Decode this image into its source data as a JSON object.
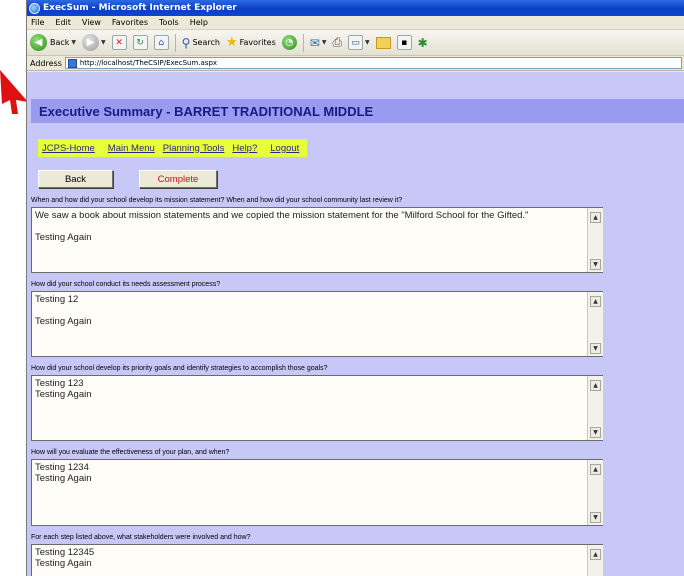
{
  "window": {
    "title": "ExecSum - Microsoft Internet Explorer"
  },
  "menu": [
    "File",
    "Edit",
    "View",
    "Favorites",
    "Tools",
    "Help"
  ],
  "toolbar": {
    "back_label": "Back",
    "search_label": "Search",
    "favorites_label": "Favorites"
  },
  "address": {
    "label": "Address",
    "url": "http://localhost/TheCSIP/ExecSum.aspx"
  },
  "page": {
    "title": "Executive Summary - BARRET TRADITIONAL MIDDLE",
    "nav": [
      "JCPS-Home",
      "Main Menu",
      "Planning Tools",
      "Help?",
      "Logout"
    ],
    "back_button": "Back",
    "complete_button": "Complete",
    "questions": [
      {
        "label": "When and how did your school develop its mission statement? When and how did your school community last review it?",
        "answer": "We saw a book about mission statements and we copied the mission statement for the \"Milford School for the Gifted.\"\n\nTesting Again"
      },
      {
        "label": "How did your school conduct its needs assessment process?",
        "answer": "Testing 12\n\nTesting Again"
      },
      {
        "label": "How did your school develop its priority goals and identify strategies to accomplish those goals?",
        "answer": "Testing 123\nTesting Again"
      },
      {
        "label": "How will you evaluate the effectiveness of your plan, and when?",
        "answer": "Testing 1234\nTesting Again"
      },
      {
        "label": "For each step listed above, what stakeholders were involved and how?",
        "answer": "Testing 12345\nTesting Again"
      }
    ]
  },
  "colors": {
    "annotation_arrow": "#e01010",
    "page_background": "#c8c8f8",
    "header_band": "#9a9af0",
    "nav_highlight": "#e6ff3a",
    "complete_text": "#d01010"
  }
}
